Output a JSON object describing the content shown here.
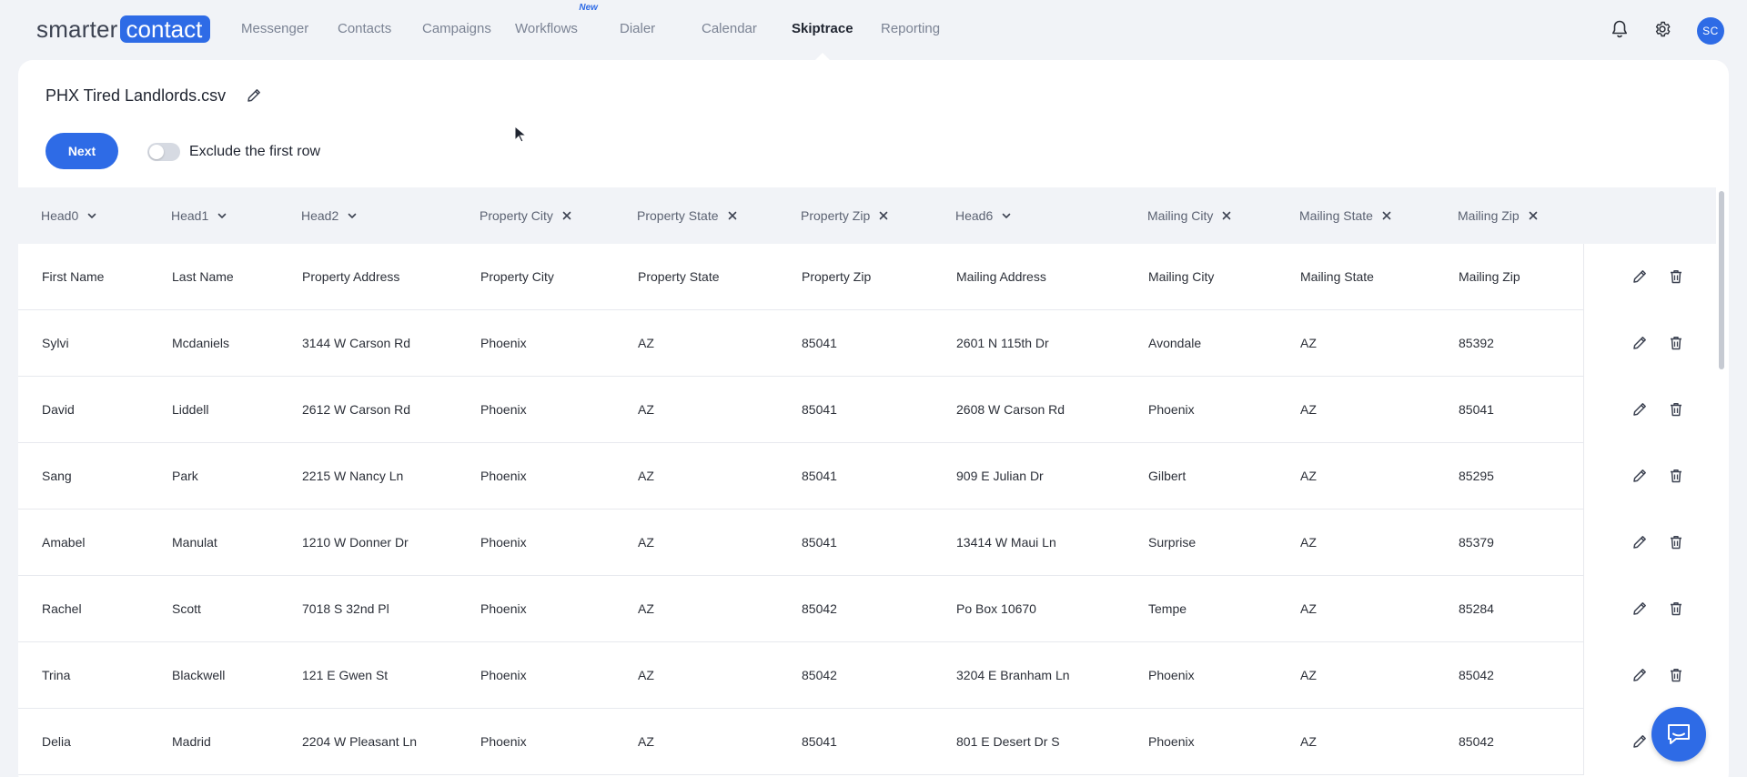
{
  "brand": {
    "part1": "smarter",
    "part2": "contact"
  },
  "nav": [
    {
      "label": "Messenger",
      "active": false
    },
    {
      "label": "Contacts",
      "active": false
    },
    {
      "label": "Campaigns",
      "active": false
    },
    {
      "label": "Workflows",
      "active": false,
      "badge": "New"
    },
    {
      "label": "Dialer",
      "active": false
    },
    {
      "label": "Calendar",
      "active": false
    },
    {
      "label": "Skiptrace",
      "active": true
    },
    {
      "label": "Reporting",
      "active": false
    }
  ],
  "user": {
    "initials": "SC"
  },
  "page": {
    "title": "PHX Tired Landlords.csv",
    "next_label": "Next",
    "exclude_label": "Exclude the first row",
    "exclude_enabled": false
  },
  "table": {
    "columns": [
      {
        "label": "Head0",
        "icon": "chevron-down"
      },
      {
        "label": "Head1",
        "icon": "chevron-down"
      },
      {
        "label": "Head2",
        "icon": "chevron-down"
      },
      {
        "label": "Property City",
        "icon": "close"
      },
      {
        "label": "Property State",
        "icon": "close"
      },
      {
        "label": "Property Zip",
        "icon": "close"
      },
      {
        "label": "Head6",
        "icon": "chevron-down"
      },
      {
        "label": "Mailing City",
        "icon": "close"
      },
      {
        "label": "Mailing State",
        "icon": "close"
      },
      {
        "label": "Mailing Zip",
        "icon": "close"
      }
    ],
    "rows": [
      [
        "First Name",
        "Last Name",
        "Property Address",
        "Property City",
        "Property State",
        "Property Zip",
        "Mailing Address",
        "Mailing City",
        "Mailing State",
        "Mailing Zip"
      ],
      [
        "Sylvi",
        "Mcdaniels",
        "3144 W Carson Rd",
        "Phoenix",
        "AZ",
        "85041",
        "2601 N 115th Dr",
        "Avondale",
        "AZ",
        "85392"
      ],
      [
        "David",
        "Liddell",
        "2612 W Carson Rd",
        "Phoenix",
        "AZ",
        "85041",
        "2608 W Carson Rd",
        "Phoenix",
        "AZ",
        "85041"
      ],
      [
        "Sang",
        "Park",
        "2215 W Nancy Ln",
        "Phoenix",
        "AZ",
        "85041",
        "909 E Julian Dr",
        "Gilbert",
        "AZ",
        "85295"
      ],
      [
        "Amabel",
        "Manulat",
        "1210 W Donner Dr",
        "Phoenix",
        "AZ",
        "85041",
        "13414 W Maui Ln",
        "Surprise",
        "AZ",
        "85379"
      ],
      [
        "Rachel",
        "Scott",
        "7018 S 32nd Pl",
        "Phoenix",
        "AZ",
        "85042",
        "Po Box 10670",
        "Tempe",
        "AZ",
        "85284"
      ],
      [
        "Trina",
        "Blackwell",
        "121 E Gwen St",
        "Phoenix",
        "AZ",
        "85042",
        "3204 E Branham Ln",
        "Phoenix",
        "AZ",
        "85042"
      ],
      [
        "Delia",
        "Madrid",
        "2204 W Pleasant Ln",
        "Phoenix",
        "AZ",
        "85041",
        "801 E Desert Dr S",
        "Phoenix",
        "AZ",
        "85042"
      ]
    ]
  },
  "colors": {
    "accent": "#2e6be6",
    "background": "#f1f3f7"
  }
}
